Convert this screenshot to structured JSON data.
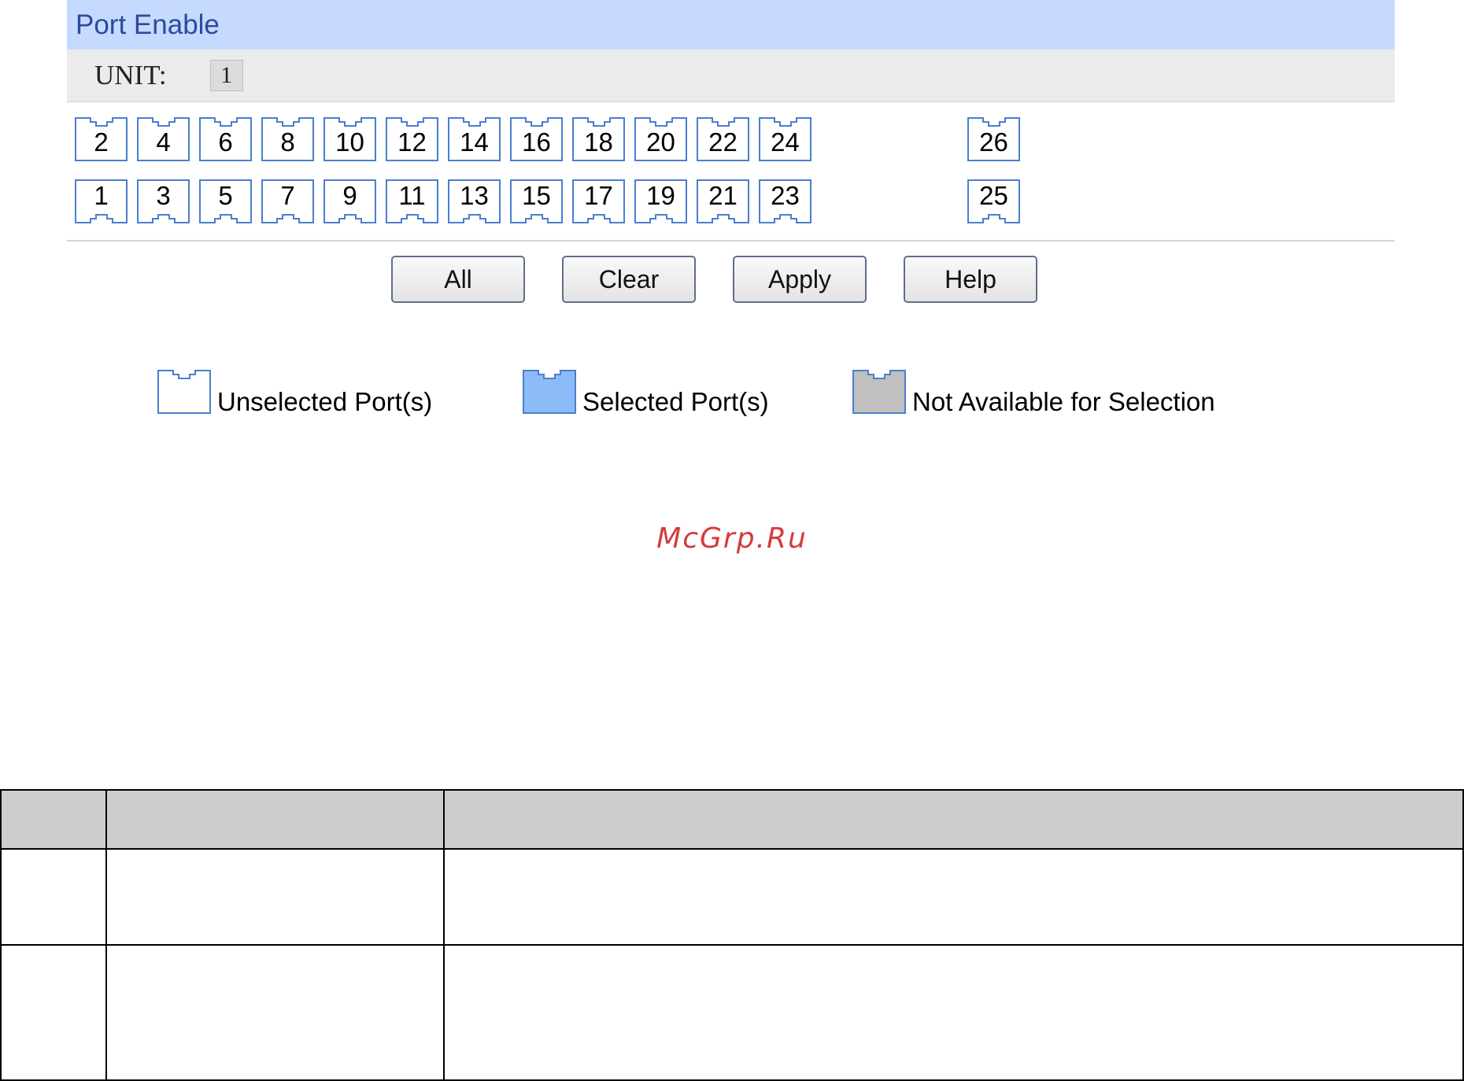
{
  "panel": {
    "title": "Port Enable",
    "unit_label": "UNIT:",
    "unit_value": "1"
  },
  "ports": {
    "top_row": [
      "2",
      "4",
      "6",
      "8",
      "10",
      "12",
      "14",
      "16",
      "18",
      "20",
      "22",
      "24",
      "26"
    ],
    "bottom_row": [
      "1",
      "3",
      "5",
      "7",
      "9",
      "11",
      "13",
      "15",
      "17",
      "19",
      "21",
      "23",
      "25"
    ],
    "state": "unselected"
  },
  "buttons": {
    "all": "All",
    "clear": "Clear",
    "apply": "Apply",
    "help": "Help"
  },
  "legend": {
    "unselected": "Unselected Port(s)",
    "selected": "Selected Port(s)",
    "unavailable": "Not Available for Selection"
  },
  "colors": {
    "header_bg": "#c6d9ff",
    "title_text": "#2b4a9c",
    "port_outline": "#4a7fcf",
    "selected_fill": "#8bbcf8",
    "unavailable_fill": "#c0c0c0",
    "table_header_bg": "#cccccc",
    "watermark": "#d63a3a"
  },
  "watermark": "McGrp.Ru"
}
